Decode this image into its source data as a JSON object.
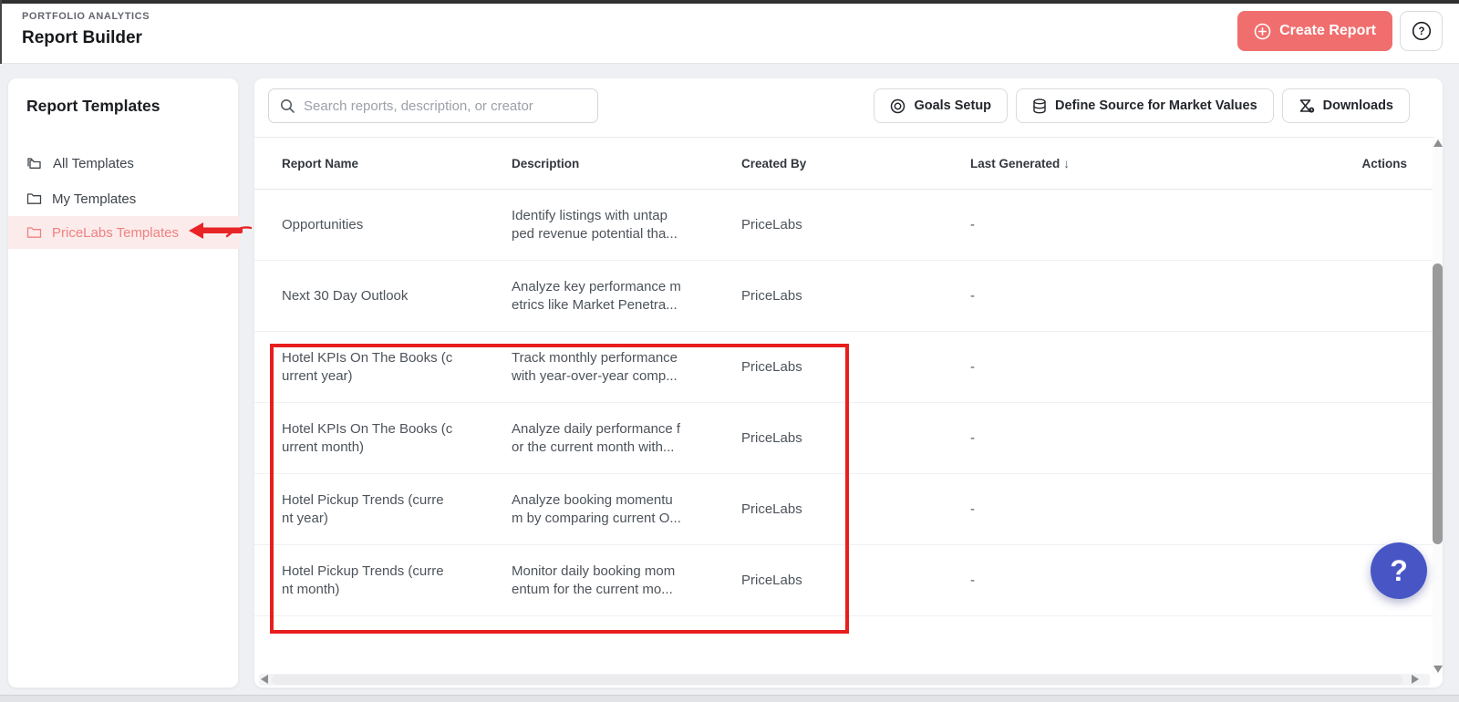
{
  "header": {
    "eyebrow": "PORTFOLIO ANALYTICS",
    "title": "Report Builder",
    "create_button": "Create Report",
    "help_glyph": "?"
  },
  "sidebar": {
    "title": "Report Templates",
    "items": [
      {
        "label": "All Templates",
        "selected": false
      },
      {
        "label": "My Templates",
        "selected": false
      },
      {
        "label": "PriceLabs Templates",
        "selected": true
      }
    ]
  },
  "toolbar": {
    "search_placeholder": "Search reports, description, or creator",
    "search_value": "",
    "goals_button": "Goals Setup",
    "source_button": "Define Source for Market Values",
    "downloads_button": "Downloads"
  },
  "table": {
    "columns": {
      "name": "Report Name",
      "description": "Description",
      "created_by": "Created By",
      "last_generated": "Last Generated",
      "actions": "Actions"
    },
    "sort": {
      "column": "Last Generated",
      "direction": "desc",
      "glyph": "↓"
    },
    "rows": [
      {
        "name": "Opportunities",
        "description": "Identify listings with untap\nped revenue potential tha...",
        "created_by": "PriceLabs",
        "last_generated": "-"
      },
      {
        "name": "Next 30 Day Outlook",
        "description": "Analyze key performance m\netrics like Market Penetra...",
        "created_by": "PriceLabs",
        "last_generated": "-"
      },
      {
        "name": "Hotel KPIs On The Books (c\nurrent year)",
        "description": "Track monthly performance\nwith year-over-year comp...",
        "created_by": "PriceLabs",
        "last_generated": "-"
      },
      {
        "name": "Hotel KPIs On The Books (c\nurrent month)",
        "description": "Analyze daily performance f\nor the current month with...",
        "created_by": "PriceLabs",
        "last_generated": "-"
      },
      {
        "name": "Hotel Pickup Trends (curre\nnt year)",
        "description": "Analyze booking momentu\nm by comparing current O...",
        "created_by": "PriceLabs",
        "last_generated": "-"
      },
      {
        "name": "Hotel Pickup Trends (curre\nnt month)",
        "description": "Monitor daily booking mom\nentum for the current mo...",
        "created_by": "PriceLabs",
        "last_generated": "-"
      }
    ]
  },
  "annotations": {
    "highlighted_sidebar_item": "PriceLabs Templates",
    "highlighted_rows": [
      "Hotel KPIs On The Books (current year)",
      "Hotel KPIs On The Books (current month)",
      "Hotel Pickup Trends (current year)",
      "Hotel Pickup Trends (current month)"
    ],
    "annotation_color": "#e81d1d"
  },
  "floating_help": {
    "glyph": "?"
  },
  "colors": {
    "accent_coral": "#f06e6e",
    "selected_pink_bg": "#fcebeb",
    "selected_pink_text": "#ef8181",
    "help_bubble_blue": "#4756c4",
    "page_background": "#eef0f3"
  }
}
